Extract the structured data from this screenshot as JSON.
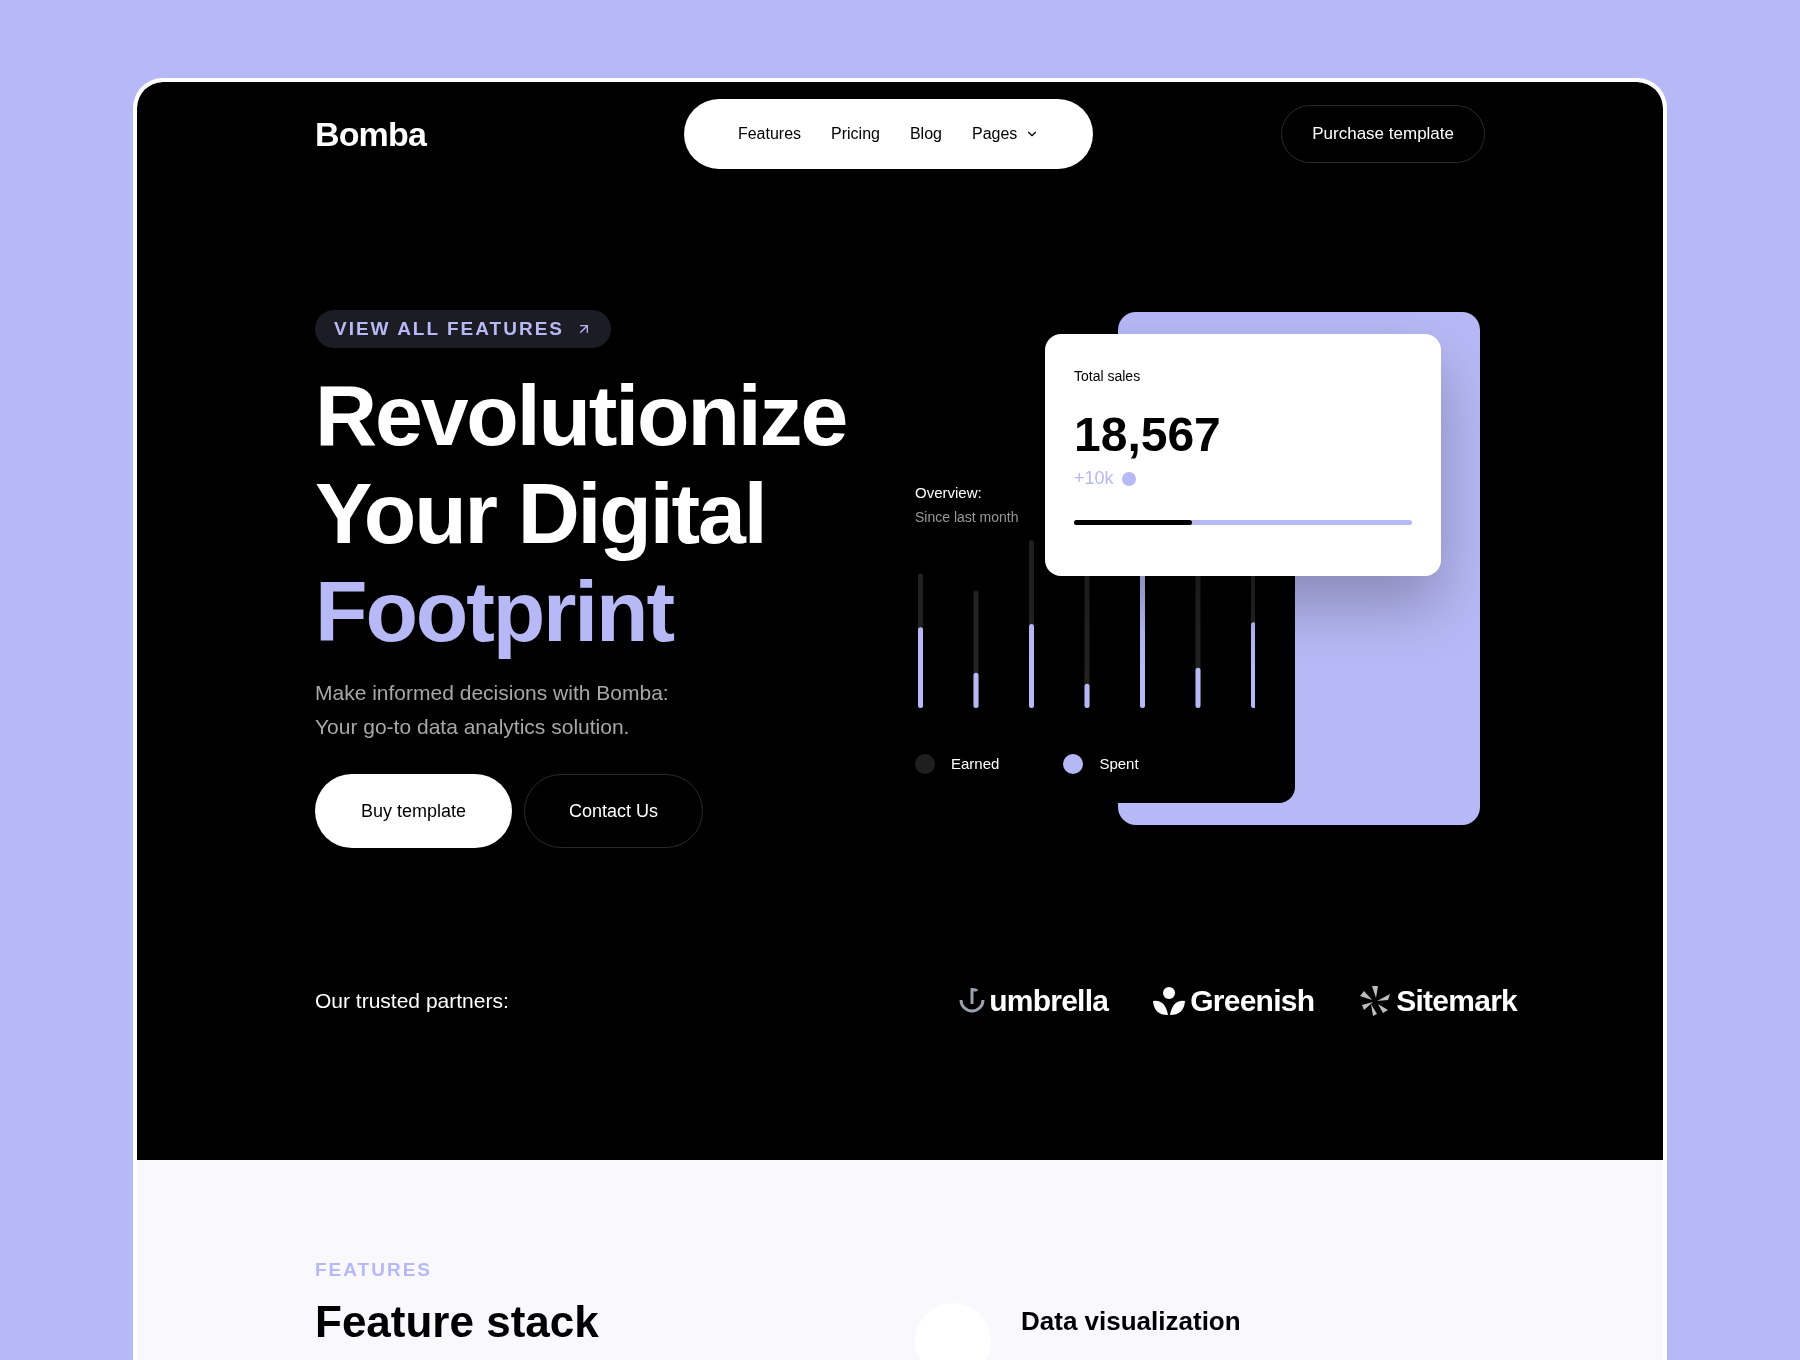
{
  "header": {
    "logo": "Bomba",
    "nav": [
      {
        "label": "Features",
        "kind": "link"
      },
      {
        "label": "Pricing",
        "kind": "link"
      },
      {
        "label": "Blog",
        "kind": "link"
      },
      {
        "label": "Pages",
        "kind": "dropdown"
      }
    ],
    "cta": "Purchase template"
  },
  "hero": {
    "badge": "VIEW ALL FEATURES",
    "title_lines": [
      "Revolutionize",
      "Your Digital"
    ],
    "title_accent": "Footprint",
    "subtitle_lines": [
      "Make informed decisions with Bomba:",
      "Your go-to data analytics solution."
    ],
    "buttons": [
      {
        "label": "Buy template",
        "kind": "primary"
      },
      {
        "label": "Contact Us",
        "kind": "secondary"
      }
    ]
  },
  "overview": {
    "title": "Overview:",
    "subtitle": "Since last month",
    "legend": [
      {
        "label": "Earned",
        "color": "#1f1f1f"
      },
      {
        "label": "Spent",
        "color": "#b4b8f5"
      }
    ]
  },
  "sales_card": {
    "title": "Total sales",
    "value": "18,567",
    "change": "+10k",
    "level": 0.35
  },
  "partners": {
    "label": "Our trusted partners:",
    "logos": [
      {
        "name": "umbrella",
        "kind": "umbrella"
      },
      {
        "name": "Greenish",
        "kind": "greenish"
      },
      {
        "name": "Sitemark",
        "kind": "sitemark"
      }
    ]
  },
  "features": {
    "eyebrow": "FEATURES",
    "title": "Feature stack",
    "item_title": "Data visualization"
  }
}
